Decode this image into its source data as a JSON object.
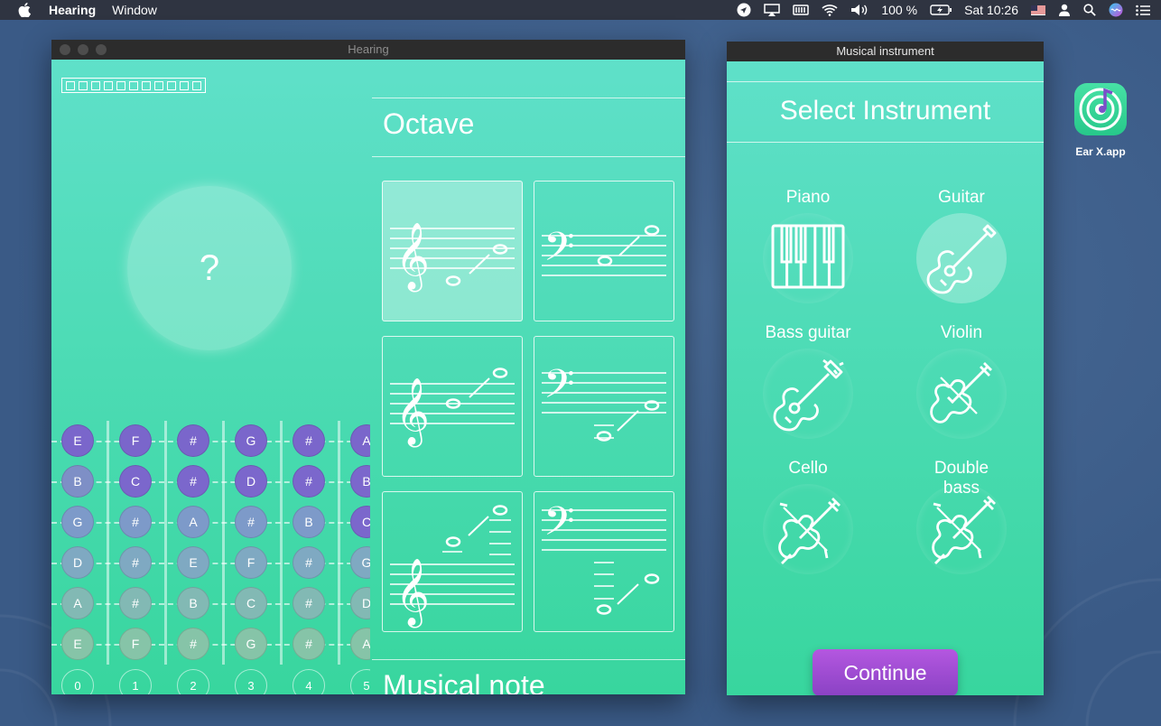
{
  "menubar": {
    "app_name": "Hearing",
    "menu_window": "Window",
    "battery": "100 %",
    "clock": "Sat 10:26"
  },
  "hearing_window": {
    "title": "Hearing",
    "question_mark": "?",
    "fretboard": {
      "rows": [
        [
          "E",
          "F",
          "#",
          "G",
          "#",
          "A"
        ],
        [
          "B",
          "C",
          "#",
          "D",
          "#",
          "B"
        ],
        [
          "G",
          "#",
          "A",
          "#",
          "B",
          "C"
        ],
        [
          "D",
          "#",
          "E",
          "F",
          "#",
          "G"
        ],
        [
          "A",
          "#",
          "B",
          "C",
          "#",
          "D"
        ],
        [
          "E",
          "F",
          "#",
          "G",
          "#",
          "A"
        ]
      ],
      "fret_numbers": [
        "0",
        "1",
        "2",
        "3",
        "4",
        "5"
      ]
    },
    "octave_title": "Octave",
    "musical_note_title": "Musical note"
  },
  "instrument_window": {
    "title": "Musical instrument",
    "heading": "Select Instrument",
    "instruments": [
      {
        "label": "Piano"
      },
      {
        "label": "Guitar"
      },
      {
        "label": "Bass guitar"
      },
      {
        "label": "Violin"
      },
      {
        "label": "Cello"
      },
      {
        "label": "Double bass"
      }
    ],
    "selected": "Guitar",
    "continue_label": "Continue"
  },
  "desktop": {
    "icon_label": "Ear X.app"
  },
  "colors": {
    "accent_purple": "#7d6ad1",
    "note_blue": "#7b97c9",
    "note_teal": "#7dc4ab",
    "continue_button": "#a24fd6"
  }
}
